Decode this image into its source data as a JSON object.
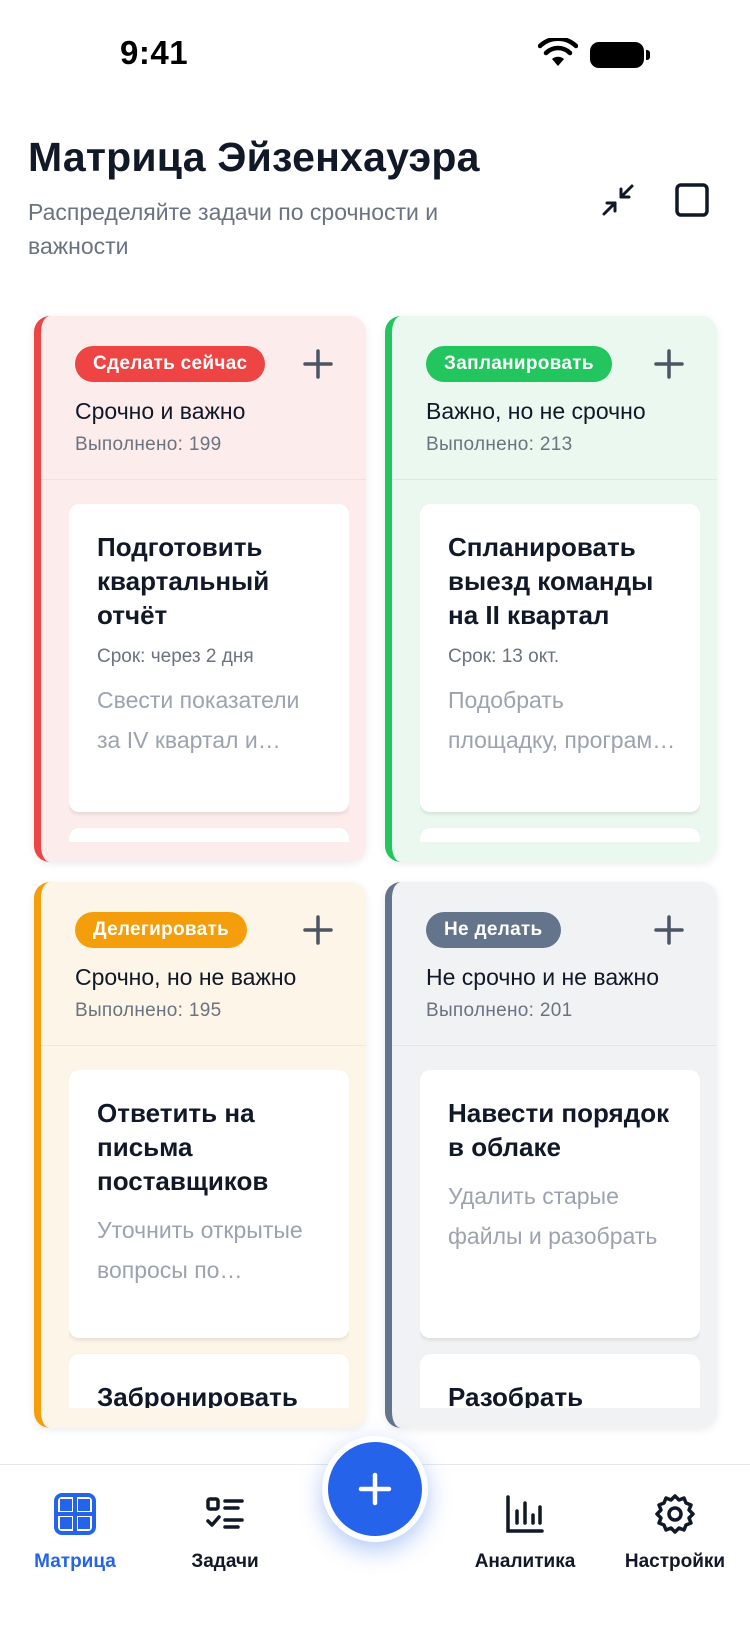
{
  "status": {
    "time": "9:41"
  },
  "header": {
    "title": "Матрица Эйзенхауэра",
    "subtitle": "Распределяйте задачи по срочности и важности"
  },
  "colors": {
    "do": "#ef4444",
    "plan": "#22c55e",
    "delegate": "#f59e0b",
    "eliminate": "#64748b",
    "accent": "#2563eb"
  },
  "quadrants": [
    {
      "badge": "Сделать сейчас",
      "subtitle": "Срочно и важно",
      "done": "Выполнено: 199",
      "cards": [
        {
          "title": "Подготовить квартальный отчёт",
          "due": "Срок: через 2 дня",
          "desc": "Свести показатели за IV квартал и подготовить"
        },
        {
          "title": "",
          "due": "",
          "desc": ""
        }
      ]
    },
    {
      "badge": "Запланировать",
      "subtitle": "Важно, но не срочно",
      "done": "Выполнено: 213",
      "cards": [
        {
          "title": "Спланировать выезд команды на II квартал",
          "due": "Срок: 13 окт.",
          "desc": "Подобрать площадку, программу и бюджет"
        },
        {
          "title": "",
          "due": "",
          "desc": ""
        }
      ]
    },
    {
      "badge": "Делегировать",
      "subtitle": "Срочно, но не важно",
      "done": "Выполнено: 195",
      "cards": [
        {
          "title": "Ответить на письма поставщиков",
          "desc": "Уточнить открытые вопросы по поставкам"
        },
        {
          "title": "Забронировать"
        }
      ]
    },
    {
      "badge": "Не делать",
      "subtitle": "Не срочно и не важно",
      "done": "Выполнено: 201",
      "cards": [
        {
          "title": "Навести порядок в облаке",
          "desc": "Удалить старые файлы и разобрать"
        },
        {
          "title": "Разобрать"
        }
      ]
    }
  ],
  "tabs": {
    "matrix": "Матрица",
    "tasks": "Задачи",
    "analytics": "Аналитика",
    "settings": "Настройки"
  }
}
